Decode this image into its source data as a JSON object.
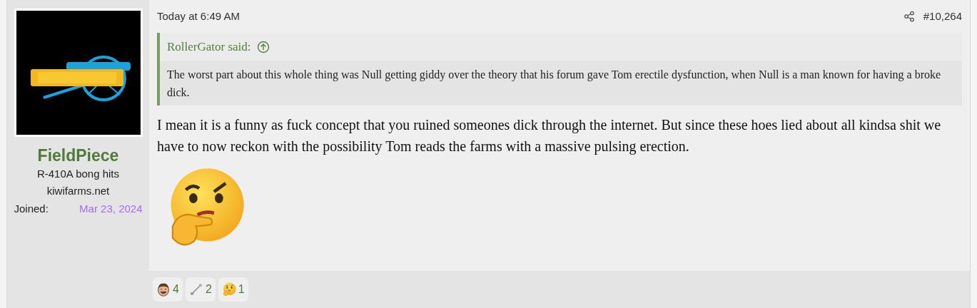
{
  "author": {
    "name": "FieldPiece",
    "title": "R-410A bong hits",
    "site": "kiwifarms.net",
    "joined_label": "Joined:",
    "joined_date": "Mar 23, 2024"
  },
  "post": {
    "time": "Today at 6:49 AM",
    "number": "#10,264",
    "quote": {
      "author": "RollerGator said:",
      "text": "The worst part about this whole thing was Null getting giddy over the theory that his forum gave Tom erectile dysfunction, when Null is a man known for having a broke dick."
    },
    "body": "I mean it is a funny as fuck concept that you ruined someones dick through the internet. But since these hoes lied about all kindsa shit we have to now reckon with the possibility Tom reads the farms with a massive pulsing erection.",
    "emoji": {
      "kind": "thinking"
    }
  },
  "reactions": [
    {
      "kind": "laughing",
      "count": "4"
    },
    {
      "kind": "spoon",
      "count": "2"
    },
    {
      "kind": "thinking",
      "count": "1"
    }
  ]
}
